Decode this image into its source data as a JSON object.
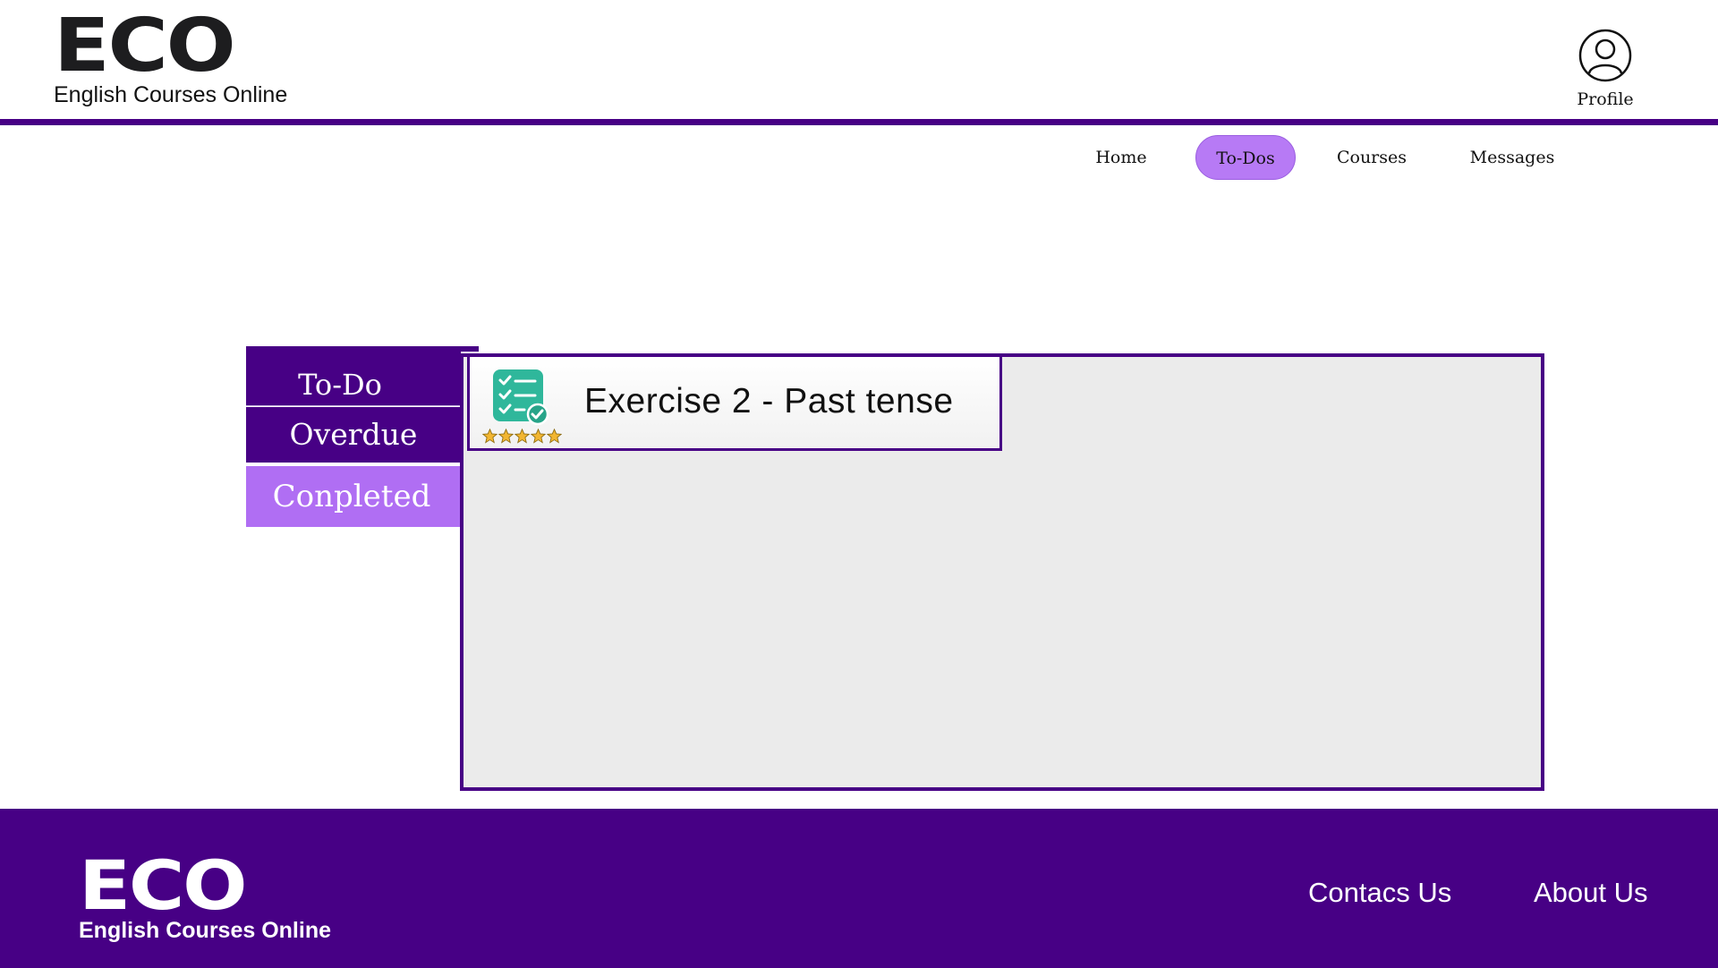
{
  "brand": {
    "logo_text": "ECO",
    "tagline": "English Courses Online"
  },
  "profile": {
    "label": "Profile",
    "icon": "user-circle-icon"
  },
  "nav": {
    "items": [
      {
        "label": "Home",
        "active": false
      },
      {
        "label": "To-Dos",
        "active": true
      },
      {
        "label": "Courses",
        "active": false
      },
      {
        "label": "Messages",
        "active": false
      }
    ]
  },
  "tabs": {
    "items": [
      {
        "label": "To-Do",
        "selected": false
      },
      {
        "label": "Overdue",
        "selected": false
      },
      {
        "label": "Conpleted",
        "selected": true
      }
    ]
  },
  "content": {
    "cards": [
      {
        "title": "Exercise 2 - Past tense",
        "icon": "checklist-icon",
        "rating": 5,
        "rating_max": 5
      }
    ]
  },
  "footer": {
    "logo_text": "ECO",
    "tagline": "English Courses Online",
    "links": [
      {
        "label": "Contacs Us"
      },
      {
        "label": "About Us"
      }
    ]
  },
  "colors": {
    "primary": "#470085",
    "accent": "#b06ef3",
    "nav_active": "#b77af5",
    "panel_bg": "#ebebeb",
    "star": "#f2b632",
    "icon_teal": "#2fb79b"
  }
}
